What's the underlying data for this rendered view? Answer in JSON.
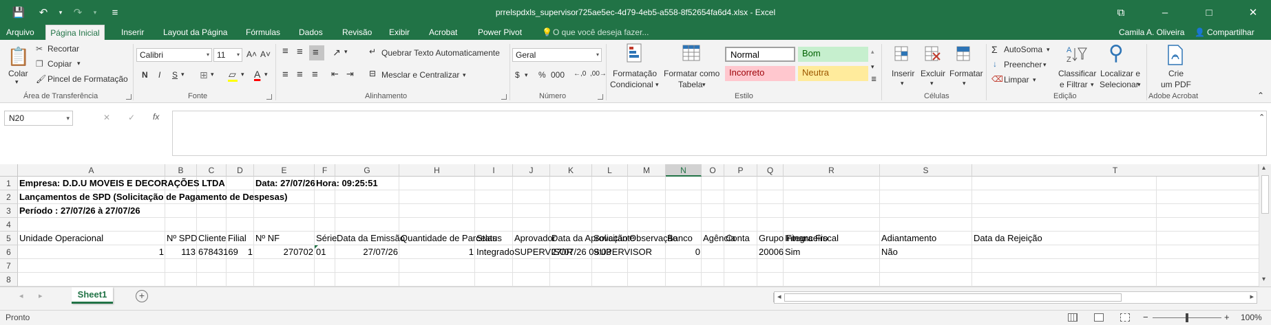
{
  "window": {
    "title": "prrelspdxls_supervisor725ae5ec-4d79-4eb5-a558-8f52654fa6d4.xlsx - Excel",
    "accent_color": "#217346"
  },
  "quick_access": {
    "icons": [
      "save-icon",
      "undo-icon",
      "redo-icon",
      "customize-qat-icon"
    ],
    "save": "💾",
    "undo": "↶",
    "undo_dd": "▾",
    "redo": "↷",
    "redo_dd": "▾",
    "customize": "≡"
  },
  "window_controls": {
    "ribbon_display": "⧉",
    "minimize": "–",
    "maximize": "□",
    "close": "✕"
  },
  "menu": {
    "tabs": [
      "Arquivo",
      "Página Inicial",
      "Inserir",
      "Layout da Página",
      "Fórmulas",
      "Dados",
      "Revisão",
      "Exibir",
      "Acrobat",
      "Power Pivot"
    ],
    "active_tab": "Página Inicial",
    "tell_me_icon": "💡",
    "tell_me": "O que você deseja fazer...",
    "user": "Camila A. Oliveira",
    "share_icon": "👤",
    "share": "Compartilhar"
  },
  "ribbon": {
    "clipboard": {
      "label": "Área de Transferência",
      "paste": "Colar",
      "paste_dd": "▾",
      "cut": "Recortar",
      "copy": "Copiar",
      "copy_dd": "▾",
      "format_painter": "Pincel de Formatação",
      "icons": {
        "paste": "📋",
        "cut": "✂",
        "copy": "❐",
        "painter": "🖌"
      }
    },
    "font": {
      "label": "Fonte",
      "name": "Calibri",
      "size": "11",
      "dd": "▾",
      "grow": "A˄",
      "shrink": "A˅",
      "bold": "N",
      "italic": "I",
      "underline": "S",
      "underline_dd": "▾",
      "borders": "⊞",
      "borders_dd": "▾",
      "fill": "▱",
      "fill_dd": "▾",
      "font_color": "A",
      "font_color_dd": "▾",
      "highlight_color": "#ffff00",
      "font_color_value": "#ff0000"
    },
    "alignment": {
      "label": "Alinhamento",
      "top": "≡",
      "middle": "≡",
      "bottom": "≡",
      "orientation": "↗",
      "orientation_dd": "▾",
      "left": "≡",
      "center": "≡",
      "right": "≡",
      "outdent": "⇤",
      "indent": "⇥",
      "wrap_text": "Quebrar Texto Automaticamente",
      "wrap_icon": "↵",
      "merge_center": "Mesclar e Centralizar",
      "merge_icon": "⊟",
      "merge_dd": "▾"
    },
    "number": {
      "label": "Número",
      "format": "Geral",
      "format_dd": "▾",
      "accounting": "$",
      "accounting_dd": "▾",
      "percent": "%",
      "comma": "000",
      "inc_decimal": "←,0",
      "dec_decimal": ",00→"
    },
    "styles": {
      "label": "Estilo",
      "conditional": "Formatação",
      "conditional2": "Condicional",
      "conditional_dd": "▾",
      "as_table": "Formatar como",
      "as_table2": "Tabela",
      "as_table_dd": "▾",
      "normal": "Normal",
      "good": "Bom",
      "bad": "Incorreto",
      "neutral": "Neutra",
      "scroll_up": "▴",
      "scroll_down": "▾",
      "more": "≣",
      "colors": {
        "good_bg": "#c6efce",
        "good_fg": "#006100",
        "bad_bg": "#ffc7ce",
        "bad_fg": "#9c0006",
        "neutral_bg": "#ffeb9c",
        "neutral_fg": "#9c5700"
      }
    },
    "cells": {
      "label": "Células",
      "insert": "Inserir",
      "delete": "Excluir",
      "format": "Formatar",
      "dd": "▾"
    },
    "editing": {
      "label": "Edição",
      "autosum": "AutoSoma",
      "autosum_icon": "Σ",
      "autosum_dd": "▾",
      "fill": "Preencher",
      "fill_icon": "↓",
      "fill_dd": "▾",
      "clear": "Limpar",
      "clear_icon": "⌫",
      "clear_dd": "▾",
      "sort": "Classificar",
      "sort2": "e Filtrar",
      "sort_dd": "▾",
      "find": "Localizar e",
      "find2": "Selecionar",
      "find_dd": "▾",
      "find_icon": "⚲"
    },
    "acrobat": {
      "label": "Adobe Acrobat",
      "create": "Crie",
      "create2": "um PDF"
    },
    "collapse": "⌃"
  },
  "formula_bar": {
    "name_box": "N20",
    "name_dd": "▾",
    "cancel": "✕",
    "enter": "✓",
    "fx": "fx",
    "content": "",
    "expand": "⌃"
  },
  "sheet": {
    "columns": [
      "A",
      "B",
      "C",
      "D",
      "E",
      "F",
      "G",
      "H",
      "I",
      "J",
      "K",
      "L",
      "M",
      "N",
      "O",
      "P",
      "Q",
      "R",
      "S",
      "T"
    ],
    "selected_column": "N",
    "rows": [
      "1",
      "2",
      "3",
      "4",
      "5",
      "6",
      "7",
      "8"
    ],
    "cells": {
      "A1": "Empresa: D.D.U MOVEIS E DECORAÇÕES LTDA",
      "E1": "Data: 27/07/26",
      "F1": "Hora: 09:25:51",
      "A2": "Lançamentos de SPD (Solicitação de Pagamento de Despesas)",
      "A3": "Período : 27/07/26 à 27/07/26",
      "A5": "Unidade Operacional",
      "B5": "Nº SPD",
      "C5": "Cliente",
      "D5": "Filial",
      "E5": "Nº NF",
      "F5": "Série",
      "G5": "Data da Emissão",
      "H5": "Quantidade de Parcelas",
      "I5": "Status",
      "J5": "Aprovador",
      "K5": "Data da Aprovação",
      "L5": "Solicitante",
      "M5": "Observação",
      "N5": "Banco",
      "O5": "Agência",
      "P5": "Conta",
      "Q5": "Grupo Financeiro",
      "R5": "Integra Fiscal",
      "S5": "Adiantamento",
      "T5": "Data da Rejeição",
      "A6": "1",
      "B6": "113",
      "C6": "67843169",
      "D6": "1",
      "E6": "270702",
      "F6": "01",
      "G6": "27/07/26",
      "H6": "1",
      "I6": "Integrado",
      "J6": "SUPERVISOR",
      "K6": "27/07/26 09:03",
      "L6": "SUPERVISOR",
      "N6": "0",
      "Q6": "20006",
      "R6": "Sim",
      "S6": "Não"
    },
    "scroll_up": "▴",
    "scroll_down": "▾",
    "scroll_left": "◂",
    "scroll_right": "▸"
  },
  "sheet_tabs": {
    "prev": "◂",
    "next": "▸",
    "active": "Sheet1",
    "add": "+"
  },
  "status": {
    "ready": "Pronto",
    "zoom": "100%",
    "zoom_level": 100,
    "zoom_minus": "−",
    "zoom_plus": "+",
    "views": [
      "normal-view-icon",
      "page-layout-icon",
      "page-break-icon"
    ]
  }
}
